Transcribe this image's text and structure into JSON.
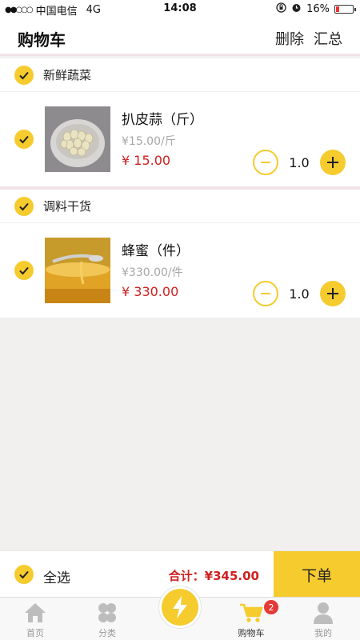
{
  "status_bar": {
    "carrier": "中国电信",
    "network": "4G",
    "time": "14:08",
    "battery": "16%",
    "battery_level": 0.16
  },
  "header": {
    "title": "购物车",
    "delete_label": "删除",
    "summary_label": "汇总"
  },
  "groups": [
    {
      "name": "新鲜蔬菜",
      "item": {
        "name": "扒皮蒜（斤）",
        "unit_price": "¥15.00/斤",
        "price": "¥ 15.00",
        "qty": "1.0"
      }
    },
    {
      "name": "调料干货",
      "item": {
        "name": "蜂蜜（件）",
        "unit_price": "¥330.00/件",
        "price": "¥ 330.00",
        "qty": "1.0"
      }
    }
  ],
  "footer": {
    "select_all": "全选",
    "total": "合计：¥345.00",
    "order_button": "下单"
  },
  "tabbar": {
    "home": "首页",
    "category": "分类",
    "cart": "购物车",
    "cart_badge": "2",
    "mine": "我的"
  },
  "colors": {
    "accent": "#f5cb2e",
    "price": "#d02020",
    "background": "#f1f0ef"
  }
}
